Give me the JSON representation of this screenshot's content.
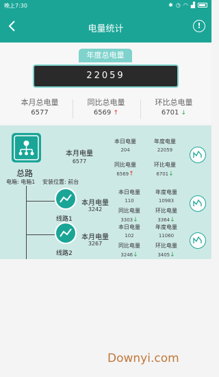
{
  "status_bar": {
    "time": "晚上7:30"
  },
  "header": {
    "title": "电量统计"
  },
  "summary": {
    "year_total_label": "年度总电量",
    "year_total_value": "22059",
    "stats": [
      {
        "label": "本月总电量",
        "value": "6577",
        "trend": ""
      },
      {
        "label": "同比总电量",
        "value": "6569",
        "trend": "↑"
      },
      {
        "label": "环比总电量",
        "value": "6701",
        "trend": "↓"
      }
    ]
  },
  "main_circuit": {
    "name": "总路",
    "box_label": "电箱: 电箱1",
    "location_label": "安装位置: 前台",
    "month_label": "本月电量",
    "month_value": "6577",
    "cells": [
      {
        "label": "本日电量",
        "value": "204",
        "trend": ""
      },
      {
        "label": "年度电量",
        "value": "22059",
        "trend": ""
      },
      {
        "label": "同比电量",
        "value": "6569",
        "trend": "↑"
      },
      {
        "label": "环比电量",
        "value": "6701",
        "trend": "↓"
      }
    ]
  },
  "branches": [
    {
      "name": "线路1",
      "month_label": "本月电量",
      "month_value": "3242",
      "cells": [
        {
          "label": "本日电量",
          "value": "110",
          "trend": ""
        },
        {
          "label": "年度电量",
          "value": "10983",
          "trend": ""
        },
        {
          "label": "同比电量",
          "value": "3303",
          "trend": "↓"
        },
        {
          "label": "环比电量",
          "value": "3364",
          "trend": "↓"
        }
      ]
    },
    {
      "name": "线路2",
      "month_label": "本月电量",
      "month_value": "3267",
      "cells": [
        {
          "label": "本日电量",
          "value": "102",
          "trend": ""
        },
        {
          "label": "年度电量",
          "value": "11060",
          "trend": ""
        },
        {
          "label": "同比电量",
          "value": "3246",
          "trend": "↓"
        },
        {
          "label": "环比电量",
          "value": "3405",
          "trend": "↓"
        }
      ]
    }
  ],
  "watermark": "Downyi.com",
  "colors": {
    "primary": "#1aa597",
    "up": "#e03030",
    "down": "#2ca44a"
  }
}
